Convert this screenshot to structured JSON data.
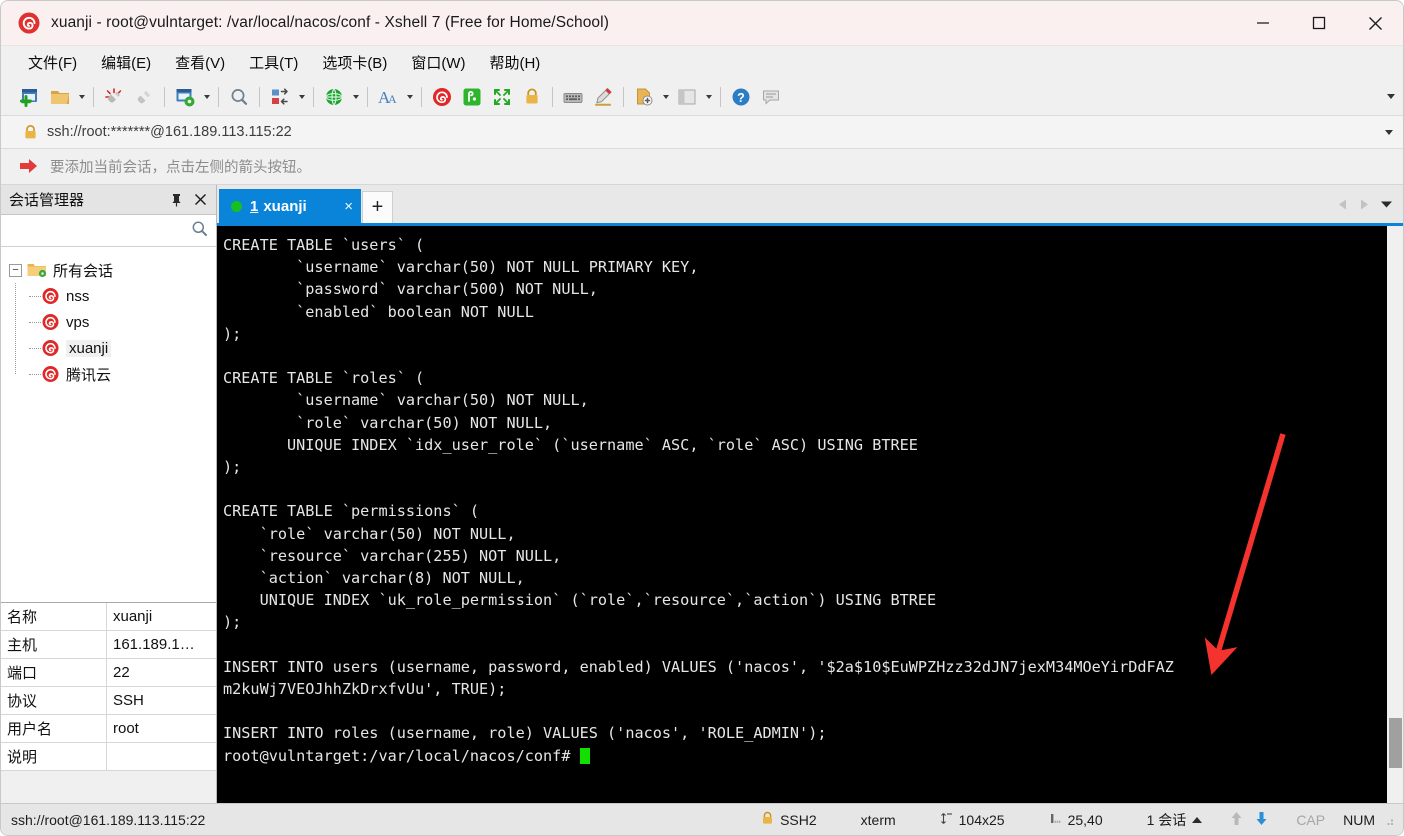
{
  "window": {
    "title": "xuanji - root@vulntarget: /var/local/nacos/conf - Xshell 7 (Free for Home/School)",
    "app_icon": "xshell-logo-icon",
    "controls": {
      "minimize": "minimize-icon",
      "maximize": "maximize-icon",
      "close": "close-icon"
    }
  },
  "menubar": {
    "items": [
      {
        "label": "文件(F)"
      },
      {
        "label": "编辑(E)"
      },
      {
        "label": "查看(V)"
      },
      {
        "label": "工具(T)"
      },
      {
        "label": "选项卡(B)"
      },
      {
        "label": "窗口(W)"
      },
      {
        "label": "帮助(H)"
      }
    ]
  },
  "toolbar": {
    "buttons": [
      {
        "name": "new-session-icon",
        "caret": false
      },
      {
        "name": "open-session-icon",
        "caret": true
      },
      {
        "name": "disconnect-icon",
        "caret": false
      },
      {
        "name": "reconnect-icon",
        "caret": false
      },
      {
        "name": "session-properties-icon",
        "caret": true
      },
      {
        "name": "find-icon",
        "caret": false
      },
      {
        "name": "file-transfer-icon",
        "caret": true
      },
      {
        "name": "tunneling-icon",
        "caret": true
      },
      {
        "name": "font-size-icon",
        "caret": true
      },
      {
        "name": "xshell-icon",
        "caret": false
      },
      {
        "name": "xftp-icon",
        "caret": false
      },
      {
        "name": "fullscreen-icon",
        "caret": false
      },
      {
        "name": "lock-icon",
        "caret": false
      },
      {
        "name": "keyboard-icon",
        "caret": false
      },
      {
        "name": "highlight-icon",
        "caret": false
      },
      {
        "name": "new-file-icon",
        "caret": true
      },
      {
        "name": "layout-icon",
        "caret": true
      },
      {
        "name": "help-icon",
        "caret": false
      },
      {
        "name": "chat-icon",
        "caret": false
      }
    ],
    "overflow": "toolbar-overflow-icon"
  },
  "addressbar": {
    "lock_icon": "lock-icon",
    "url": "ssh://root:*******@161.189.113.115:22",
    "dropdown_icon": "chevron-down-icon"
  },
  "hintbar": {
    "icon": "red-arrow-hint-icon",
    "text": "要添加当前会话，点击左侧的箭头按钮。"
  },
  "sidebar": {
    "title": "会话管理器",
    "pin_icon": "pin-icon",
    "close_icon": "close-icon",
    "search": {
      "value": "",
      "placeholder": "",
      "icon": "search-icon"
    },
    "tree": {
      "root": {
        "label": "所有会话",
        "icon": "folder-sessions-icon",
        "expander": "−"
      },
      "children": [
        {
          "label": "nss",
          "icon": "xshell-session-icon",
          "selected": false
        },
        {
          "label": "vps",
          "icon": "xshell-session-icon",
          "selected": false
        },
        {
          "label": "xuanji",
          "icon": "xshell-session-icon",
          "selected": true
        },
        {
          "label": "腾讯云",
          "icon": "xshell-session-icon",
          "selected": false
        }
      ]
    },
    "properties": [
      {
        "key": "名称",
        "value": "xuanji"
      },
      {
        "key": "主机",
        "value": "161.189.1…"
      },
      {
        "key": "端口",
        "value": "22"
      },
      {
        "key": "协议",
        "value": "SSH"
      },
      {
        "key": "用户名",
        "value": "root"
      },
      {
        "key": "说明",
        "value": ""
      }
    ]
  },
  "tabs": {
    "items": [
      {
        "status_icon": "connected-dot-icon",
        "number": "1",
        "label": "xuanji",
        "close": "×",
        "active": true
      }
    ],
    "new_tab": "+",
    "scroll_left_icon": "chevron-left-icon",
    "scroll_right_icon": "chevron-right-icon",
    "tab_list_icon": "chevron-down-icon"
  },
  "terminal": {
    "lines": [
      "CREATE TABLE `users` (",
      "        `username` varchar(50) NOT NULL PRIMARY KEY,",
      "        `password` varchar(500) NOT NULL,",
      "        `enabled` boolean NOT NULL",
      ");",
      "",
      "CREATE TABLE `roles` (",
      "        `username` varchar(50) NOT NULL,",
      "        `role` varchar(50) NOT NULL,",
      "       UNIQUE INDEX `idx_user_role` (`username` ASC, `role` ASC) USING BTREE",
      ");",
      "",
      "CREATE TABLE `permissions` (",
      "    `role` varchar(50) NOT NULL,",
      "    `resource` varchar(255) NOT NULL,",
      "    `action` varchar(8) NOT NULL,",
      "    UNIQUE INDEX `uk_role_permission` (`role`,`resource`,`action`) USING BTREE",
      ");",
      "",
      "INSERT INTO users (username, password, enabled) VALUES ('nacos', '$2a$10$EuWPZHzz32dJN7jexM34MOeYirDdFAZ",
      "m2kuWj7VEOJhhZkDrxfvUu', TRUE);",
      "",
      "INSERT INTO roles (username, role) VALUES ('nacos', 'ROLE_ADMIN');"
    ],
    "prompt": "root@vulntarget:/var/local/nacos/conf# ",
    "cursor": "block-cursor",
    "scrollbar": "terminal-scrollbar"
  },
  "annotation": {
    "type": "red-arrow",
    "color": "#f4322e"
  },
  "statusbar": {
    "connection": "ssh://root@161.189.113.115:22",
    "protocol_icon": "lock-icon",
    "protocol": "SSH2",
    "term_type": "xterm",
    "size_icon": "terminal-size-icon",
    "size": "104x25",
    "cursor_icon": "cursor-pos-icon",
    "cursor_pos": "25,40",
    "sessions": "1 会话",
    "sessions_caret": "caret-up-icon",
    "upload_icon": "upload-arrow-icon",
    "download_icon": "download-arrow-icon",
    "caps": "CAP",
    "num": "NUM",
    "grip": "resize-grip-icon"
  },
  "colors": {
    "accent": "#0a84d8",
    "titlebar_bg": "#faf0f0",
    "terminal_bg": "#000000",
    "terminal_fg": "#e6e6e6",
    "cursor": "#12e000",
    "annotation_red": "#f4322e",
    "connected_green": "#16c020"
  }
}
